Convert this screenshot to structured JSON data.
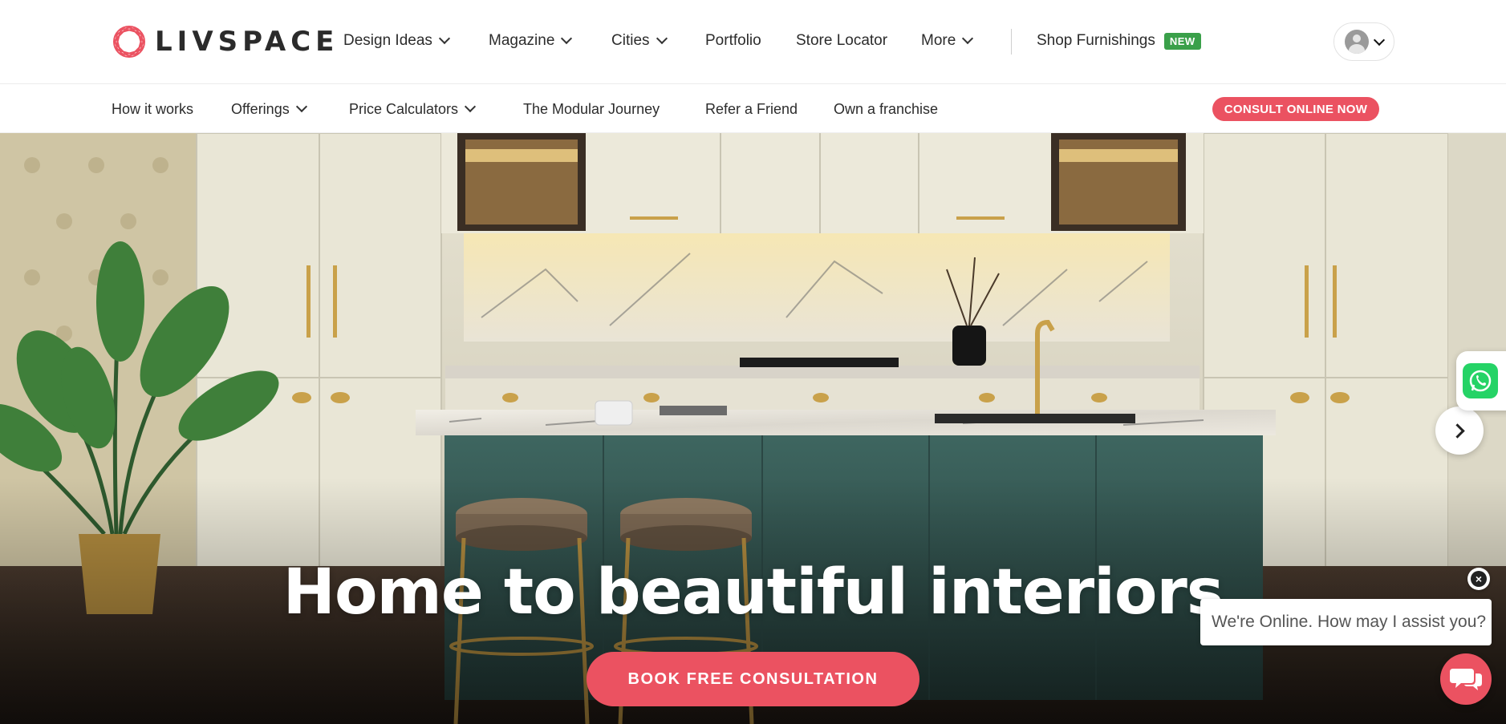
{
  "brand": {
    "name": "LIVSPACE",
    "color": "#eb5261"
  },
  "header": {
    "nav": [
      {
        "label": "Design Ideas",
        "dropdown": true
      },
      {
        "label": "Magazine",
        "dropdown": true
      },
      {
        "label": "Cities",
        "dropdown": true
      },
      {
        "label": "Portfolio",
        "dropdown": false
      },
      {
        "label": "Store Locator",
        "dropdown": false
      },
      {
        "label": "More",
        "dropdown": true
      }
    ],
    "shop": {
      "label": "Shop Furnishings",
      "badge": "NEW",
      "badge_color": "#3aa04a"
    },
    "profile_icon": "user-avatar-icon"
  },
  "subnav": {
    "items": [
      {
        "label": "How it works",
        "dropdown": false
      },
      {
        "label": "Offerings",
        "dropdown": true
      },
      {
        "label": "Price Calculators",
        "dropdown": true
      },
      {
        "label": "The Modular Journey",
        "dropdown": false
      },
      {
        "label": "Refer a Friend",
        "dropdown": false
      },
      {
        "label": "Own a franchise",
        "dropdown": false
      }
    ],
    "cta": "CONSULT ONLINE NOW"
  },
  "hero": {
    "title": "Home to beautiful interiors",
    "cta": "BOOK FREE CONSULTATION",
    "next_icon": "chevron-right-icon"
  },
  "widgets": {
    "whatsapp_icon": "whatsapp-icon",
    "chat_message": "We're Online. How may I assist you?",
    "chat_close": "×",
    "chat_icon": "chat-bubbles-icon"
  }
}
